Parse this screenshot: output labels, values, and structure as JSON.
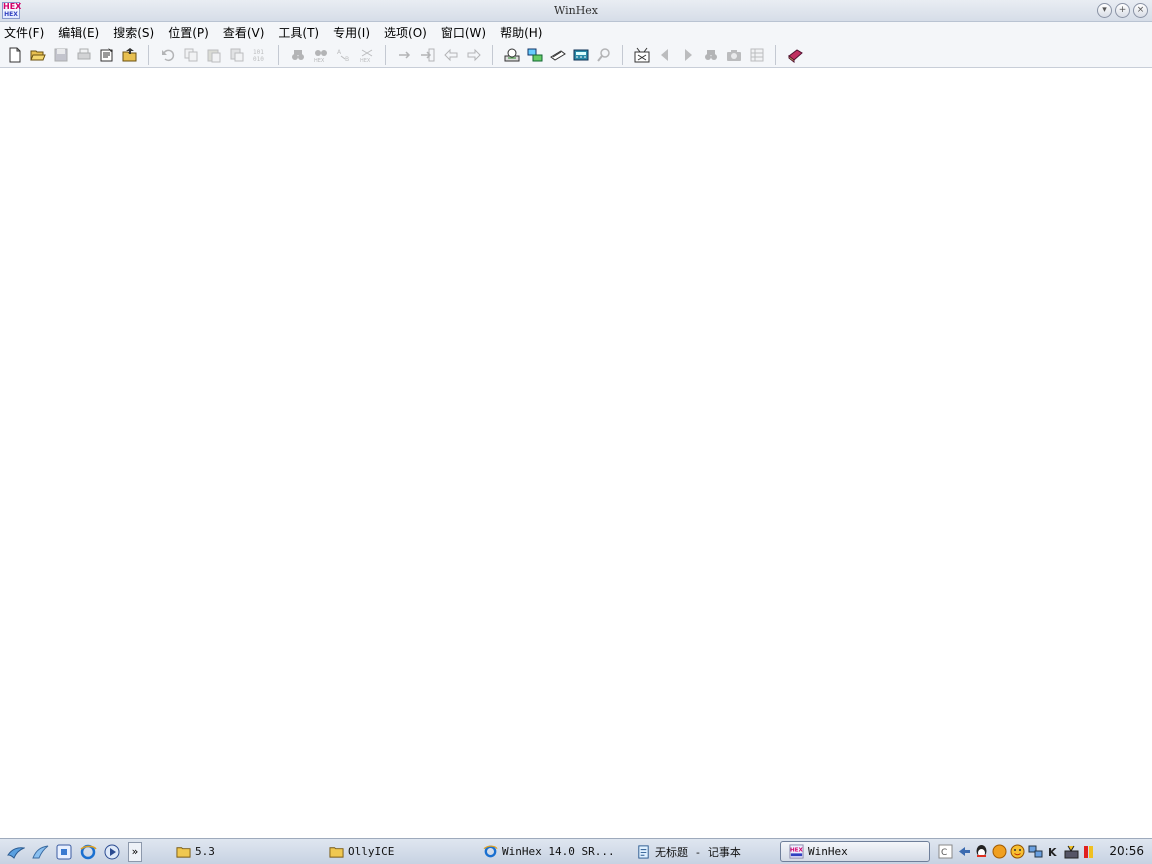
{
  "window": {
    "title": "WinHex",
    "app_icon_text": "HEX",
    "app_icon_subtext": "HEX"
  },
  "menu": {
    "items": [
      {
        "label": "文件(F)"
      },
      {
        "label": "编辑(E)"
      },
      {
        "label": "搜索(S)"
      },
      {
        "label": "位置(P)"
      },
      {
        "label": "查看(V)"
      },
      {
        "label": "工具(T)"
      },
      {
        "label": "专用(I)"
      },
      {
        "label": "选项(O)"
      },
      {
        "label": "窗口(W)"
      },
      {
        "label": "帮助(H)"
      }
    ]
  },
  "toolbar": {
    "buttons": [
      {
        "icon": "new-file-icon",
        "enabled": true
      },
      {
        "icon": "open-folder-icon",
        "enabled": true
      },
      {
        "icon": "save-icon",
        "enabled": false
      },
      {
        "icon": "print-icon",
        "enabled": false
      },
      {
        "icon": "properties-icon",
        "enabled": true
      },
      {
        "icon": "open-disk-icon",
        "enabled": true
      },
      {
        "icon": "undo-icon",
        "enabled": false
      },
      {
        "icon": "copy-icon",
        "enabled": false
      },
      {
        "icon": "paste-icon",
        "enabled": false
      },
      {
        "icon": "write-icon",
        "enabled": false
      },
      {
        "icon": "fill-block-icon",
        "enabled": false
      },
      {
        "icon": "find-text-icon",
        "enabled": false
      },
      {
        "icon": "find-hex-icon",
        "enabled": false
      },
      {
        "icon": "replace-text-icon",
        "enabled": false
      },
      {
        "icon": "replace-hex-icon",
        "enabled": false
      },
      {
        "icon": "goto-offset-icon",
        "enabled": false
      },
      {
        "icon": "goto-sector-icon",
        "enabled": false
      },
      {
        "icon": "back-icon",
        "enabled": false
      },
      {
        "icon": "forward-icon",
        "enabled": false
      },
      {
        "icon": "edit-disk-icon",
        "enabled": true
      },
      {
        "icon": "open-ram-icon",
        "enabled": true
      },
      {
        "icon": "data-interpreter-icon",
        "enabled": true
      },
      {
        "icon": "calculator-icon",
        "enabled": true
      },
      {
        "icon": "hash-icon",
        "enabled": false
      },
      {
        "icon": "snapshot-clear-icon",
        "enabled": true
      },
      {
        "icon": "prev-icon",
        "enabled": false
      },
      {
        "icon": "next-icon",
        "enabled": false
      },
      {
        "icon": "search-all-icon",
        "enabled": false
      },
      {
        "icon": "camera-icon",
        "enabled": false
      },
      {
        "icon": "table-icon",
        "enabled": false
      },
      {
        "icon": "help-book-icon",
        "enabled": true
      }
    ]
  },
  "taskbar": {
    "quicklaunch": [
      "wing-icon",
      "feather-icon",
      "desktop-icon",
      "ie-icon",
      "media-player-icon"
    ],
    "chevron": "»",
    "tasks": [
      {
        "label": "5.3",
        "icon": "folder-icon",
        "active": false
      },
      {
        "label": "OllyICE",
        "icon": "folder-icon",
        "active": false
      },
      {
        "label": "WinHex 14.0 SR...",
        "icon": "ie-icon",
        "active": false
      },
      {
        "label": "无标题 - 记事本",
        "icon": "notepad-icon",
        "active": false
      },
      {
        "label": "WinHex",
        "icon": "winhex-icon",
        "active": true
      }
    ],
    "tray_icons": [
      "ime-icon",
      "arrow-icon",
      "qq-icon",
      "orange-icon",
      "face-icon",
      "network-icon",
      "k-icon",
      "shield-icon",
      "flag-icon"
    ],
    "clock": "20:56"
  },
  "colors": {
    "accent": "#3040c0",
    "hex_logo": "#d4006a",
    "taskbar": "#c7d2e2"
  }
}
